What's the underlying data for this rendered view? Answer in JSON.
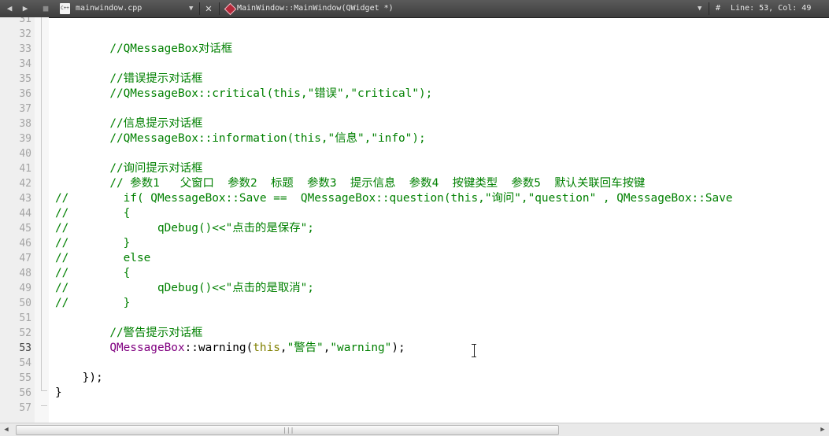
{
  "toolbar": {
    "back_icon": "◀",
    "forward_icon": "▶",
    "lock_icon": "■",
    "file_icon_label": "C++",
    "file_name": "mainwindow.cpp",
    "close_icon": "✕",
    "function_name": "MainWindow::MainWindow(QWidget *)",
    "hash": "#",
    "cursor_position": "Line: 53, Col: 49",
    "dropdown_icon": "▼"
  },
  "editor": {
    "current_line": 53,
    "lines": [
      {
        "n": "31",
        "parts": []
      },
      {
        "n": "32",
        "parts": []
      },
      {
        "n": "33",
        "parts": [
          {
            "t": "        "
          },
          {
            "t": "//QMessageBox对话框",
            "c": "comment"
          }
        ]
      },
      {
        "n": "34",
        "parts": []
      },
      {
        "n": "35",
        "parts": [
          {
            "t": "        "
          },
          {
            "t": "//错误提示对话框",
            "c": "comment"
          }
        ]
      },
      {
        "n": "36",
        "parts": [
          {
            "t": "        "
          },
          {
            "t": "//QMessageBox::critical(this,\"错误\",\"critical\");",
            "c": "comment"
          }
        ]
      },
      {
        "n": "37",
        "parts": []
      },
      {
        "n": "38",
        "parts": [
          {
            "t": "        "
          },
          {
            "t": "//信息提示对话框",
            "c": "comment"
          }
        ]
      },
      {
        "n": "39",
        "parts": [
          {
            "t": "        "
          },
          {
            "t": "//QMessageBox::information(this,\"信息\",\"info\");",
            "c": "comment"
          }
        ]
      },
      {
        "n": "40",
        "parts": []
      },
      {
        "n": "41",
        "parts": [
          {
            "t": "        "
          },
          {
            "t": "//询问提示对话框",
            "c": "comment"
          }
        ]
      },
      {
        "n": "42",
        "parts": [
          {
            "t": "        "
          },
          {
            "t": "// 参数1   父窗口  参数2  标题  参数3  提示信息  参数4  按键类型  参数5  默认关联回车按键",
            "c": "comment"
          }
        ]
      },
      {
        "n": "43",
        "parts": [
          {
            "t": "//        if( QMessageBox::Save ==  QMessageBox::question(this,\"询问\",\"question\" , QMessageBox::Save",
            "c": "comment"
          }
        ]
      },
      {
        "n": "44",
        "parts": [
          {
            "t": "//        {",
            "c": "comment"
          }
        ]
      },
      {
        "n": "45",
        "parts": [
          {
            "t": "//             qDebug()<<\"点击的是保存\";",
            "c": "comment"
          }
        ]
      },
      {
        "n": "46",
        "parts": [
          {
            "t": "//        }",
            "c": "comment"
          }
        ]
      },
      {
        "n": "47",
        "parts": [
          {
            "t": "//        else",
            "c": "comment"
          }
        ]
      },
      {
        "n": "48",
        "parts": [
          {
            "t": "//        {",
            "c": "comment"
          }
        ]
      },
      {
        "n": "49",
        "parts": [
          {
            "t": "//             qDebug()<<\"点击的是取消\";",
            "c": "comment"
          }
        ]
      },
      {
        "n": "50",
        "parts": [
          {
            "t": "//        }",
            "c": "comment"
          }
        ]
      },
      {
        "n": "51",
        "parts": []
      },
      {
        "n": "52",
        "parts": [
          {
            "t": "        "
          },
          {
            "t": "//警告提示对话框",
            "c": "comment"
          }
        ]
      },
      {
        "n": "53",
        "parts": [
          {
            "t": "        "
          },
          {
            "t": "QMessageBox",
            "c": "type"
          },
          {
            "t": "::warning("
          },
          {
            "t": "this",
            "c": "kw"
          },
          {
            "t": ","
          },
          {
            "t": "\"警告\"",
            "c": "str"
          },
          {
            "t": ","
          },
          {
            "t": "\"warning\"",
            "c": "str"
          },
          {
            "t": ");"
          }
        ]
      },
      {
        "n": "54",
        "parts": []
      },
      {
        "n": "55",
        "parts": [
          {
            "t": "    });"
          }
        ]
      },
      {
        "n": "56",
        "parts": [
          {
            "t": "}"
          }
        ]
      },
      {
        "n": "57",
        "parts": []
      }
    ]
  },
  "scrollbar": {
    "left_arrow": "◀",
    "right_arrow": "▶",
    "grip": "|||"
  },
  "colors": {
    "comment": "#008000",
    "type": "#800080",
    "keyword": "#808000",
    "string": "#008000"
  }
}
